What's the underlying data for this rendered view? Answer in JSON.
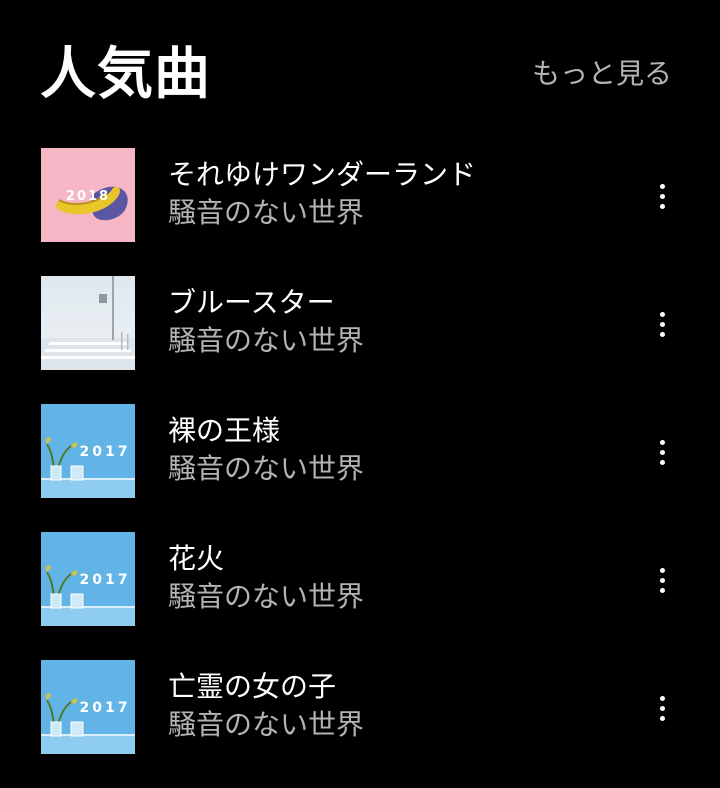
{
  "header": {
    "title": "人気曲",
    "more_label": "もっと見る"
  },
  "tracks": [
    {
      "title": "それゆけワンダーランド",
      "artist": "騒音のない世界",
      "cover": "banana-2018",
      "cover_year": "2018"
    },
    {
      "title": "ブルースター",
      "artist": "騒音のない世界",
      "cover": "crosswalk"
    },
    {
      "title": "裸の王様",
      "artist": "騒音のない世界",
      "cover": "plant-2017",
      "cover_year": "2017"
    },
    {
      "title": "花火",
      "artist": "騒音のない世界",
      "cover": "plant-2017",
      "cover_year": "2017"
    },
    {
      "title": "亡霊の女の子",
      "artist": "騒音のない世界",
      "cover": "plant-2017",
      "cover_year": "2017"
    }
  ],
  "icons": {
    "row_menu": "more-vertical-icon"
  },
  "colors": {
    "background": "#000000",
    "primary_text": "#ffffff",
    "secondary_text": "#b3b3b3",
    "cover_pink": "#f7b6c6",
    "cover_blue": "#62b4e6"
  }
}
